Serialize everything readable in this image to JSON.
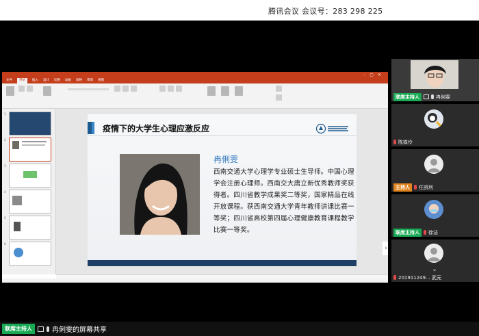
{
  "meeting": {
    "title": "腾讯会议  会议号：283 298 225"
  },
  "ppt": {
    "tabs": [
      "文件",
      "开始",
      "插入",
      "设计",
      "切换",
      "动画",
      "放映",
      "审阅",
      "视图"
    ],
    "active_tab": "开始"
  },
  "slide": {
    "title": "疫情下的大学生心理应激反应",
    "speaker_name": "冉俐雯",
    "bio": "西南交通大学心理学专业硕士生导师。中国心理学会注册心理师。西南交大唐立新优秀教师奖获得者。四川省教学成果奖二等奖，国家精品在线开放课程。获西南交通大学青年教师讲课比赛一等奖；四川省高校第四届心理健康教育课程教学比赛一等奖。"
  },
  "participants": [
    {
      "name": "冉俐雯",
      "badge": "联席主持人",
      "badge_type": "cohost"
    },
    {
      "name": "陈姝伶",
      "badge": "",
      "badge_type": ""
    },
    {
      "name": "任凯利",
      "badge": "主持人",
      "badge_type": "host"
    },
    {
      "name": "徐洁",
      "badge": "联席主持人",
      "badge_type": "cohost"
    },
    {
      "name": "201911249... 武元",
      "badge": "",
      "badge_type": ""
    }
  ],
  "bottom": {
    "badge": "联席主持人",
    "share_text": "冉俐雯的屏幕共享"
  },
  "colors": {
    "ppt_accent": "#c43e1c",
    "cohost_badge": "#1aaa55",
    "host_badge": "#e0851f",
    "slide_name": "#3a7fc2"
  }
}
